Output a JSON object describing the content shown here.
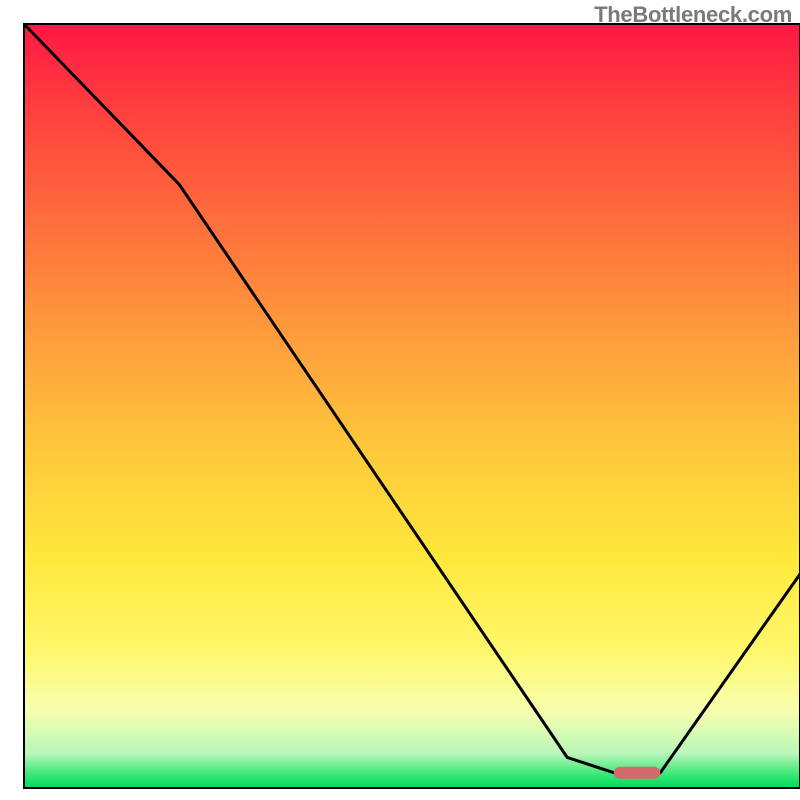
{
  "watermark": "TheBottleneck.com",
  "chart_data": {
    "type": "line",
    "title": "",
    "xlabel": "",
    "ylabel": "",
    "xlim": [
      0,
      100
    ],
    "ylim": [
      0,
      100
    ],
    "x": [
      0,
      20,
      70,
      76,
      82,
      100
    ],
    "values": [
      100,
      79,
      4,
      2,
      2,
      28
    ],
    "marker": {
      "x_start": 76,
      "x_end": 82,
      "y": 2
    },
    "gradient_stops": [
      {
        "offset": 0.0,
        "color": "#ff1744"
      },
      {
        "offset": 0.1,
        "color": "#ff3b3f"
      },
      {
        "offset": 0.25,
        "color": "#ff6b3d"
      },
      {
        "offset": 0.4,
        "color": "#ff9a3c"
      },
      {
        "offset": 0.55,
        "color": "#ffc63b"
      },
      {
        "offset": 0.7,
        "color": "#ffe83b"
      },
      {
        "offset": 0.82,
        "color": "#fff76b"
      },
      {
        "offset": 0.9,
        "color": "#f6ffb0"
      },
      {
        "offset": 0.955,
        "color": "#b8f7b8"
      },
      {
        "offset": 0.985,
        "color": "#2ee66f"
      },
      {
        "offset": 1.0,
        "color": "#00d964"
      }
    ],
    "marker_color": "#d36a6a",
    "line_color": "#000000"
  }
}
